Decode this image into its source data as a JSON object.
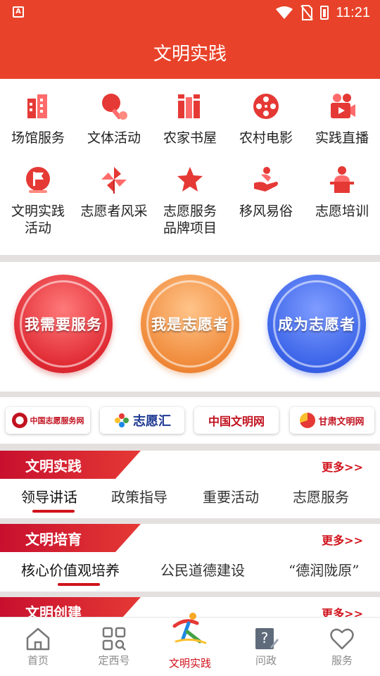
{
  "status_bar": {
    "time": "11:21",
    "app_badge": "A"
  },
  "header": {
    "title": "文明实践"
  },
  "services": [
    {
      "label": "场馆服务",
      "icon": "building-icon"
    },
    {
      "label": "文体活动",
      "icon": "ping-pong-icon"
    },
    {
      "label": "农家书屋",
      "icon": "books-icon"
    },
    {
      "label": "农村电影",
      "icon": "film-reel-icon"
    },
    {
      "label": "实践直播",
      "icon": "video-camera-icon"
    },
    {
      "label": "文明实践\n活动",
      "icon": "flag-icon"
    },
    {
      "label": "志愿者风采",
      "icon": "pinwheel-icon"
    },
    {
      "label": "志愿服务\n品牌项目",
      "icon": "star-icon"
    },
    {
      "label": "移风易俗",
      "icon": "hand-care-icon"
    },
    {
      "label": "志愿培训",
      "icon": "lecturer-icon"
    }
  ],
  "actions": [
    {
      "label": "我需要服务",
      "color": "#e02a33"
    },
    {
      "label": "我是志愿者",
      "color": "#f08a3a"
    },
    {
      "label": "成为志愿者",
      "color": "#3a63e8"
    }
  ],
  "links": [
    {
      "label": "中国志愿服务网"
    },
    {
      "label": "志愿汇"
    },
    {
      "label": "中国文明网"
    },
    {
      "label": "甘肃文明网"
    }
  ],
  "sections": [
    {
      "title": "文明实践",
      "more": "更多>>",
      "tabs": [
        "领导讲话",
        "政策指导",
        "重要活动",
        "志愿服务"
      ],
      "active_tab": 0
    },
    {
      "title": "文明培育",
      "more": "更多>>",
      "tabs": [
        "核心价值观培养",
        "公民道德建设",
        "“德润陇原”"
      ],
      "active_tab": 0
    },
    {
      "title": "文明创建",
      "more": "更多>>",
      "tabs": [],
      "active_tab": 0
    }
  ],
  "bottom_nav": [
    {
      "label": "首页",
      "icon": "home-icon"
    },
    {
      "label": "定西号",
      "icon": "grid-search-icon"
    },
    {
      "label": "文明实践",
      "icon": "runner-logo-icon"
    },
    {
      "label": "问政",
      "icon": "question-edit-icon"
    },
    {
      "label": "服务",
      "icon": "heart-icon"
    }
  ],
  "colors": {
    "primary": "#e8432a",
    "accent": "#d0121b"
  }
}
